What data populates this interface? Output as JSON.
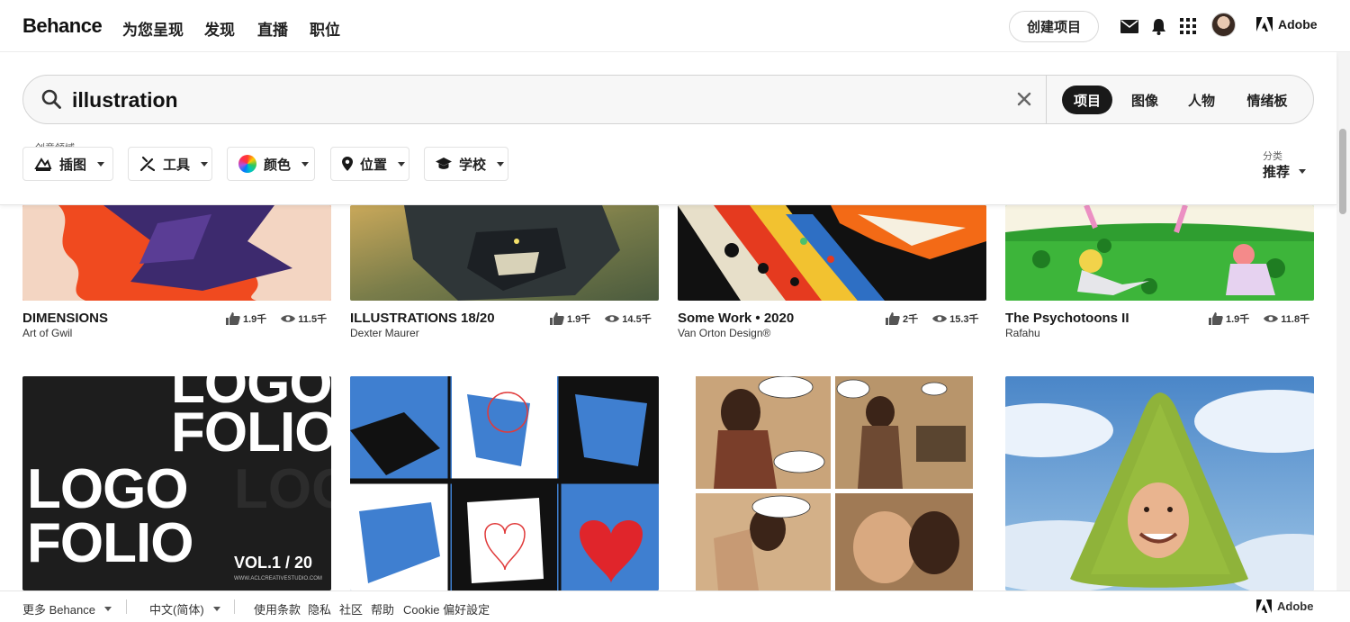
{
  "nav": {
    "logo": "Behance",
    "links": [
      "为您呈现",
      "发现",
      "直播",
      "职位"
    ],
    "create_label": "创建项目",
    "adobe_label": "Adobe"
  },
  "search": {
    "query": "illustration",
    "tabs": [
      "项目",
      "图像",
      "人物",
      "情绪板"
    ],
    "active_tab": "项目"
  },
  "filters": {
    "field_caption": "创意领域",
    "items": [
      "插图",
      "工具",
      "颜色",
      "位置",
      "学校"
    ],
    "sort_caption": "分类",
    "sort_value": "推荐"
  },
  "projects": [
    {
      "title": "DIMENSIONS",
      "owner": "Art of Gwil",
      "likes": "1.9千",
      "views": "11.5千"
    },
    {
      "title": "ILLUSTRATIONS 18/20",
      "owner": "Dexter Maurer",
      "likes": "1.9千",
      "views": "14.5千"
    },
    {
      "title": "Some Work • 2020",
      "owner": "Van Orton Design®",
      "likes": "2千",
      "views": "15.3千"
    },
    {
      "title": "The Psychotoons II",
      "owner": "Rafahu",
      "likes": "1.9千",
      "views": "11.8千"
    }
  ],
  "row2": {
    "logofolio": {
      "line1": "LOGO",
      "line2": "FOLIO",
      "vol": "VOL.1 / 20",
      "site": "WWW.ACLCREATIVESTUDIO.COM"
    }
  },
  "footer": {
    "more": "更多 Behance",
    "language": "中文(简体)",
    "links": [
      "使用条款",
      "隐私",
      "社区",
      "帮助",
      "Cookie 偏好設定"
    ],
    "adobe_label": "Adobe"
  },
  "colors": {
    "accent": "#191919",
    "brand_blue": "#0057ff"
  }
}
